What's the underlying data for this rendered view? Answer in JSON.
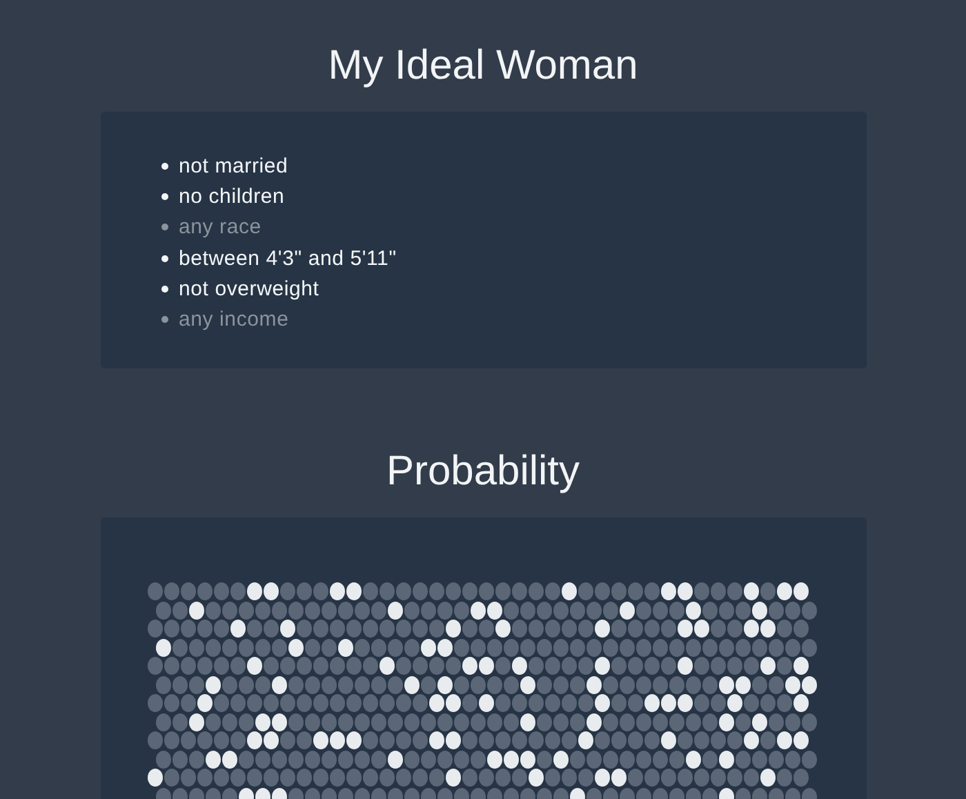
{
  "ideal": {
    "title": "My Ideal Woman",
    "items": [
      {
        "text": "not married",
        "muted": false
      },
      {
        "text": "no children",
        "muted": false
      },
      {
        "text": "any race",
        "muted": true
      },
      {
        "text": "between 4'3\" and 5'11\"",
        "muted": false
      },
      {
        "text": "not overweight",
        "muted": false
      },
      {
        "text": "any income",
        "muted": true
      }
    ]
  },
  "probability": {
    "title": "Probability",
    "rows": [
      [
        false,
        false,
        false,
        false,
        false,
        false,
        true,
        true,
        false,
        false,
        false,
        true,
        true,
        false,
        false,
        false,
        false,
        false,
        false,
        false,
        false,
        false,
        false,
        false,
        false,
        true,
        false,
        false,
        false,
        false,
        false,
        true,
        true,
        false,
        false,
        false,
        true,
        false,
        true,
        true
      ],
      [
        false,
        false,
        true,
        false,
        false,
        false,
        false,
        false,
        false,
        false,
        false,
        false,
        false,
        false,
        true,
        false,
        false,
        false,
        false,
        true,
        true,
        false,
        false,
        false,
        false,
        false,
        false,
        false,
        true,
        false,
        false,
        false,
        true,
        false,
        false,
        false,
        true,
        false,
        false,
        false
      ],
      [
        false,
        false,
        false,
        false,
        false,
        true,
        false,
        false,
        true,
        false,
        false,
        false,
        false,
        false,
        false,
        false,
        false,
        false,
        true,
        false,
        false,
        true,
        false,
        false,
        false,
        false,
        false,
        true,
        false,
        false,
        false,
        false,
        true,
        true,
        false,
        false,
        true,
        true,
        false,
        false
      ],
      [
        true,
        false,
        false,
        false,
        false,
        false,
        false,
        false,
        true,
        false,
        false,
        true,
        false,
        false,
        false,
        false,
        true,
        true,
        false,
        false,
        false,
        false,
        false,
        false,
        false,
        false,
        false,
        false,
        false,
        false,
        false,
        false,
        false,
        false,
        false,
        false,
        false,
        false,
        false,
        false
      ],
      [
        false,
        false,
        false,
        false,
        false,
        false,
        true,
        false,
        false,
        false,
        false,
        false,
        false,
        false,
        true,
        false,
        false,
        false,
        false,
        true,
        true,
        false,
        true,
        false,
        false,
        false,
        false,
        true,
        false,
        false,
        false,
        false,
        true,
        false,
        false,
        false,
        false,
        true,
        false,
        true
      ],
      [
        false,
        false,
        false,
        true,
        false,
        false,
        false,
        true,
        false,
        false,
        false,
        false,
        false,
        false,
        false,
        true,
        false,
        true,
        false,
        false,
        false,
        false,
        true,
        false,
        false,
        false,
        true,
        false,
        false,
        false,
        false,
        false,
        false,
        false,
        true,
        true,
        false,
        false,
        true,
        true
      ],
      [
        false,
        false,
        false,
        true,
        false,
        false,
        false,
        false,
        false,
        false,
        false,
        false,
        false,
        false,
        false,
        false,
        false,
        true,
        true,
        false,
        true,
        false,
        false,
        false,
        false,
        false,
        false,
        true,
        false,
        false,
        true,
        true,
        true,
        false,
        false,
        true,
        false,
        false,
        false,
        true
      ],
      [
        false,
        false,
        true,
        false,
        false,
        false,
        true,
        true,
        false,
        false,
        false,
        false,
        false,
        false,
        false,
        false,
        false,
        false,
        false,
        false,
        false,
        false,
        true,
        false,
        false,
        false,
        true,
        false,
        false,
        false,
        false,
        false,
        false,
        false,
        true,
        false,
        true,
        false,
        false,
        false
      ],
      [
        false,
        false,
        false,
        false,
        false,
        false,
        true,
        true,
        false,
        false,
        true,
        true,
        true,
        false,
        false,
        false,
        false,
        true,
        true,
        false,
        false,
        false,
        false,
        false,
        false,
        false,
        true,
        false,
        false,
        false,
        false,
        true,
        false,
        false,
        false,
        false,
        true,
        false,
        true,
        true
      ],
      [
        false,
        false,
        false,
        true,
        true,
        false,
        false,
        false,
        false,
        false,
        false,
        false,
        false,
        false,
        true,
        false,
        false,
        false,
        false,
        false,
        true,
        true,
        true,
        false,
        true,
        false,
        false,
        false,
        false,
        false,
        false,
        false,
        true,
        false,
        true,
        false,
        false,
        false,
        false,
        false
      ],
      [
        true,
        false,
        false,
        false,
        false,
        false,
        false,
        false,
        false,
        false,
        false,
        false,
        false,
        false,
        false,
        false,
        false,
        false,
        true,
        false,
        false,
        false,
        false,
        true,
        false,
        false,
        false,
        true,
        true,
        false,
        false,
        false,
        false,
        false,
        false,
        false,
        false,
        true,
        false,
        false
      ],
      [
        false,
        false,
        false,
        false,
        false,
        true,
        true,
        true,
        false,
        false,
        false,
        false,
        false,
        false,
        false,
        false,
        false,
        false,
        false,
        false,
        false,
        false,
        false,
        false,
        false,
        true,
        false,
        false,
        false,
        false,
        false,
        false,
        false,
        false,
        true,
        false,
        false,
        false,
        false,
        false
      ]
    ]
  }
}
